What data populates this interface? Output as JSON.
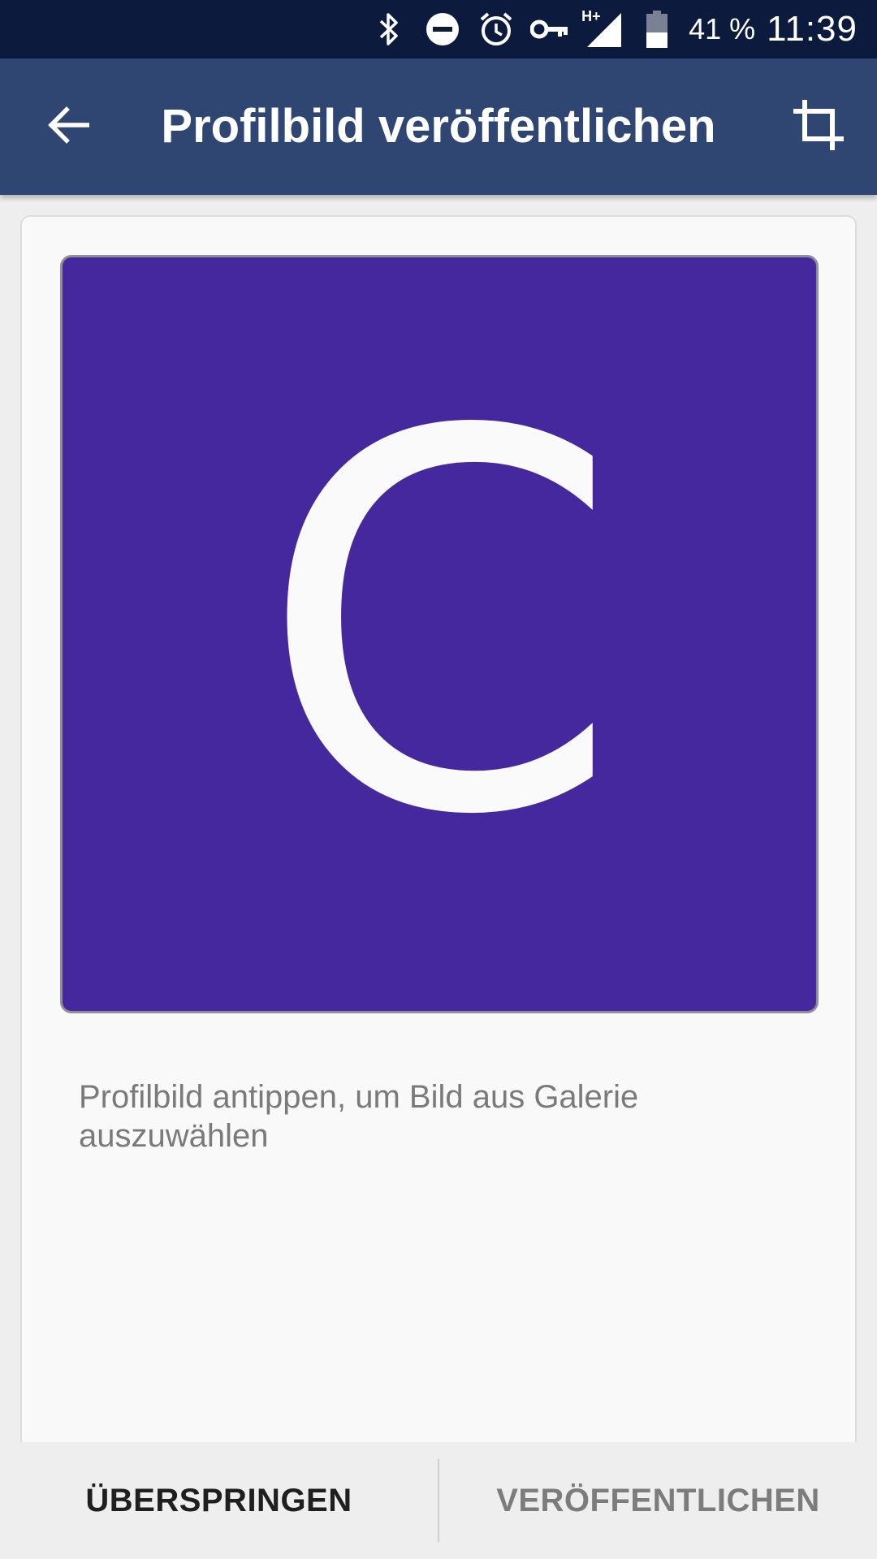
{
  "status_bar": {
    "battery_percent": "41 %",
    "time": "11:39",
    "network_label": "H+",
    "icons": [
      "bluetooth-icon",
      "do-not-disturb-icon",
      "alarm-icon",
      "vpn-key-icon",
      "signal-icon",
      "battery-icon"
    ]
  },
  "app_bar": {
    "title": "Profilbild veröffentlichen",
    "back_icon": "arrow-back-icon",
    "crop_icon": "crop-icon",
    "background_color": "#2f4572"
  },
  "profile": {
    "initial": "C",
    "avatar_color": "#45289d",
    "hint": "Profilbild antippen, um Bild aus Galerie auszuwählen"
  },
  "actions": {
    "skip_label": "ÜBERSPRINGEN",
    "publish_label": "VERÖFFENTLICHEN"
  }
}
